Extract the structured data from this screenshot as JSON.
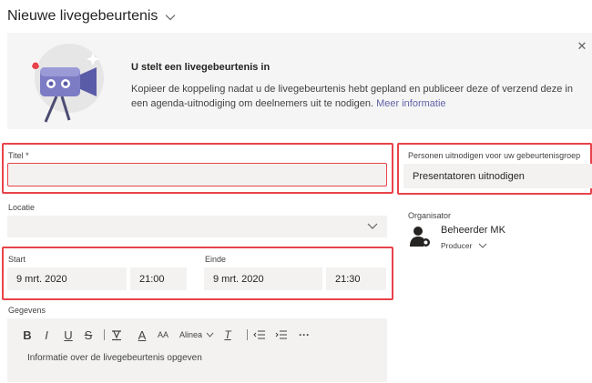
{
  "header": {
    "title": "Nieuwe livegebeurtenis"
  },
  "banner": {
    "title": "U stelt een livegebeurtenis in",
    "text": "Kopieer de koppeling nadat u de livegebeurtenis hebt gepland en publiceer deze of verzend deze in een agenda-uitnodiging om deelnemers uit te nodigen.",
    "link": "Meer informatie",
    "close_glyph": "✕"
  },
  "form": {
    "title_label": "Titel *",
    "title_value": "",
    "location_label": "Locatie",
    "location_value": "",
    "start_label": "Start",
    "start_date": "9 mrt. 2020",
    "start_time": "21:00",
    "end_label": "Einde",
    "end_date": "9 mrt. 2020",
    "end_time": "21:30",
    "details_label": "Gegevens",
    "details_placeholder": "Informatie over de livegebeurtenis opgeven"
  },
  "invite": {
    "label": "Personen uitnodigen voor uw gebeurtenisgroep",
    "placeholder": "Presentatoren uitnodigen"
  },
  "organizer": {
    "label": "Organisator",
    "name": "Beheerder MK",
    "role": "Producer"
  },
  "toolbar": {
    "bold": "B",
    "italic": "I",
    "underline": "U",
    "strike": "S",
    "font_color": "A",
    "font_size": "AA",
    "paragraph": "Alinea",
    "clear_format": "T",
    "more": "···"
  },
  "colors": {
    "accent": "#6264a7",
    "highlight": "#e8434a",
    "field_bg": "#f3f2f1"
  }
}
